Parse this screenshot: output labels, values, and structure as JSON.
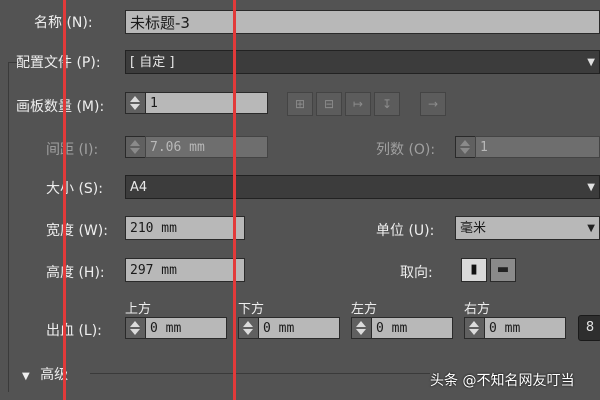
{
  "name": {
    "label": "名称 (N):",
    "value": "未标题-3"
  },
  "profile": {
    "label": "配置文件 (P):",
    "value": "[ 自定 ]"
  },
  "artboards": {
    "label": "画板数量 (M):",
    "value": "1",
    "layout_icons": [
      "grid-by-row-icon",
      "grid-by-column-icon",
      "arrange-by-row-icon",
      "arrange-by-column-icon",
      "right-to-left-icon"
    ]
  },
  "spacing": {
    "label": "间距 (I):",
    "value": "7.06 mm"
  },
  "columns": {
    "label": "列数 (O):",
    "value": "1"
  },
  "size": {
    "label": "大小 (S):",
    "value": "A4"
  },
  "width": {
    "label": "宽度 (W):",
    "value": "210 mm"
  },
  "units": {
    "label": "单位 (U):",
    "value": "毫米"
  },
  "height": {
    "label": "高度 (H):",
    "value": "297 mm"
  },
  "orientation": {
    "label": "取向:",
    "portrait_icon": "portrait-icon",
    "landscape_icon": "landscape-icon"
  },
  "bleed": {
    "label": "出血 (L):",
    "top": {
      "label": "上方",
      "value": "0 mm"
    },
    "bottom": {
      "label": "下方",
      "value": "0 mm"
    },
    "left": {
      "label": "左方",
      "value": "0 mm"
    },
    "right": {
      "label": "右方",
      "value": "0 mm"
    },
    "link_icon": "chain-link-icon"
  },
  "advanced": {
    "label": "高级"
  },
  "watermark": {
    "text": "头条 @不知名网友叮当"
  },
  "colors": {
    "panel": "#535353",
    "field": "#b8b8b8",
    "annotation_line": "#e23a3a"
  }
}
